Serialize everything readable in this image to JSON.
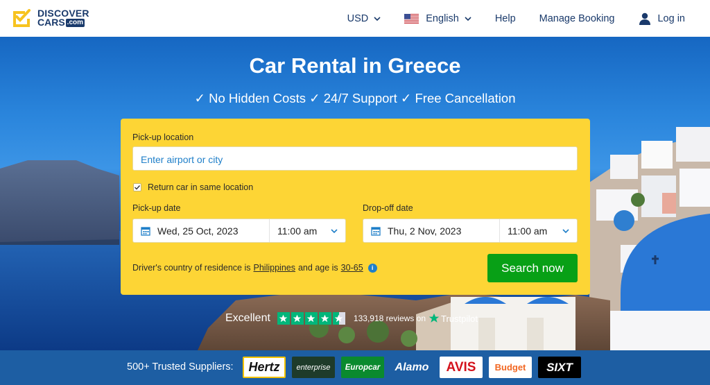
{
  "header": {
    "logo": {
      "line1": "DISCOVER",
      "line2": "CARS",
      "com": ".com"
    },
    "nav": {
      "currency": "USD",
      "language": "English",
      "help": "Help",
      "manage_booking": "Manage Booking",
      "login": "Log in"
    }
  },
  "hero": {
    "title": "Car Rental in Greece",
    "subtitle": "✓ No Hidden Costs ✓ 24/7 Support ✓ Free Cancellation"
  },
  "search": {
    "pickup_location_label": "Pick-up location",
    "pickup_location_placeholder": "Enter airport or city",
    "return_same_label": "Return car in same location",
    "return_same_checked": true,
    "pickup_date_label": "Pick-up date",
    "pickup_date": "Wed, 25 Oct, 2023",
    "pickup_time": "11:00 am",
    "dropoff_date_label": "Drop-off date",
    "dropoff_date": "Thu, 2 Nov, 2023",
    "dropoff_time": "11:00 am",
    "residence_prefix": "Driver's country of residence is",
    "residence_country": "Philippines",
    "age_prefix": "and age is",
    "age_range": "30-65",
    "search_button": "Search now"
  },
  "trustpilot": {
    "rating_text": "Excellent",
    "stars": 4.5,
    "reviews": "133,918 reviews on",
    "brand": "Trustpilot"
  },
  "suppliers": {
    "label": "500+ Trusted Suppliers:",
    "brands": [
      "Hertz",
      "enterprise",
      "Europcar",
      "Alamo",
      "AVIS",
      "Budget",
      "SIXT"
    ]
  },
  "colors": {
    "navy": "#1a3a6b",
    "card_yellow": "#fdd535",
    "search_green": "#08a016",
    "link_blue": "#1f7fc9",
    "trust_green": "#00b67a",
    "suppliers_bar": "#1d5ea3"
  }
}
